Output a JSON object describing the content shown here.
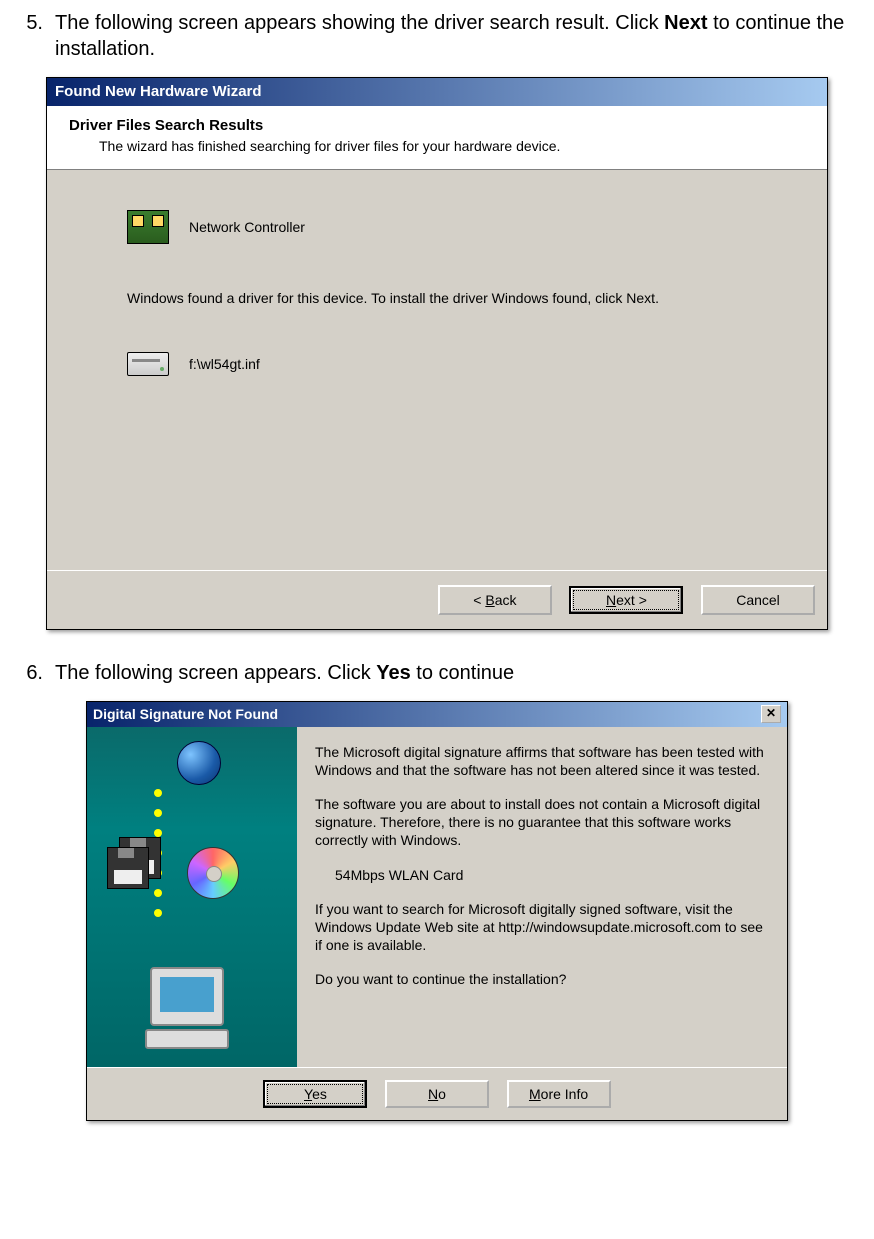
{
  "step5": {
    "num": "5.",
    "text_a": "The following screen appears showing the driver search result. Click ",
    "text_b": "Next",
    "text_c": " to continue the installation."
  },
  "wizard1": {
    "title": "Found New Hardware Wizard",
    "header_title": "Driver Files Search Results",
    "header_sub": "The wizard has finished searching for driver files for your hardware device.",
    "device_name": "Network Controller",
    "found_msg": "Windows found a driver for this device. To install the driver Windows found, click Next.",
    "inf_path": "f:\\wl54gt.inf",
    "btn_back_pre": "< ",
    "btn_back_u": "B",
    "btn_back_post": "ack",
    "btn_next_u": "N",
    "btn_next_post": "ext >",
    "btn_cancel": "Cancel"
  },
  "step6": {
    "num": "6.",
    "text_a": "The following screen appears. Click ",
    "text_b": "Yes",
    "text_c": " to continue"
  },
  "wizard2": {
    "title": "Digital Signature Not Found",
    "p1": "The Microsoft digital signature affirms that software has been tested with Windows and that the software has not been altered since it was tested.",
    "p2": "The software you are about to install does not contain a Microsoft digital signature. Therefore,  there is no guarantee that this software works correctly with Windows.",
    "device": "54Mbps WLAN Card",
    "p3": "If you want to search for Microsoft digitally signed software, visit the Windows Update Web site at http://windowsupdate.microsoft.com to see if one is available.",
    "p4": "Do you want to continue the installation?",
    "btn_yes_u": "Y",
    "btn_yes_post": "es",
    "btn_no_u": "N",
    "btn_no_post": "o",
    "btn_more_u": "M",
    "btn_more_post": "ore Info"
  }
}
